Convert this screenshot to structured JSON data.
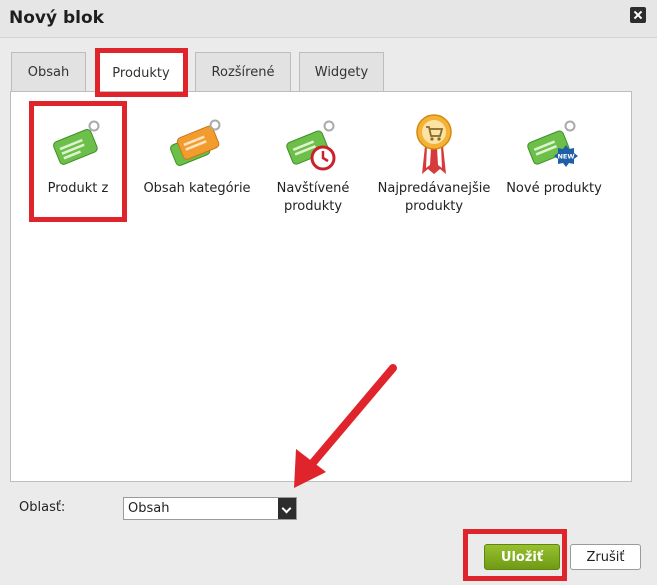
{
  "dialog": {
    "title": "Nový blok",
    "close_icon": "close-icon"
  },
  "tabs": [
    {
      "label": "Obsah",
      "active": false
    },
    {
      "label": "Produkty",
      "active": true
    },
    {
      "label": "Rozšírené",
      "active": false
    },
    {
      "label": "Widgety",
      "active": false
    }
  ],
  "items": [
    {
      "label": "Produkt z",
      "icon": "green-tag-icon"
    },
    {
      "label": "Obsah kategórie",
      "icon": "orange-tag-icon"
    },
    {
      "label": "Navštívené produkty",
      "icon": "tag-clock-icon"
    },
    {
      "label": "Najpredávanejšie produkty",
      "icon": "medal-cart-icon"
    },
    {
      "label": "Nové produkty",
      "icon": "tag-new-icon",
      "badge": "NEW"
    }
  ],
  "area": {
    "label": "Oblasť:",
    "value": "Obsah"
  },
  "buttons": {
    "save": "Uložiť",
    "cancel": "Zrušiť"
  },
  "colors": {
    "accent_green": "#86b221",
    "highlight_red": "#e0242b",
    "tag_green": "#6cc04a",
    "tag_orange": "#f39c2e"
  }
}
